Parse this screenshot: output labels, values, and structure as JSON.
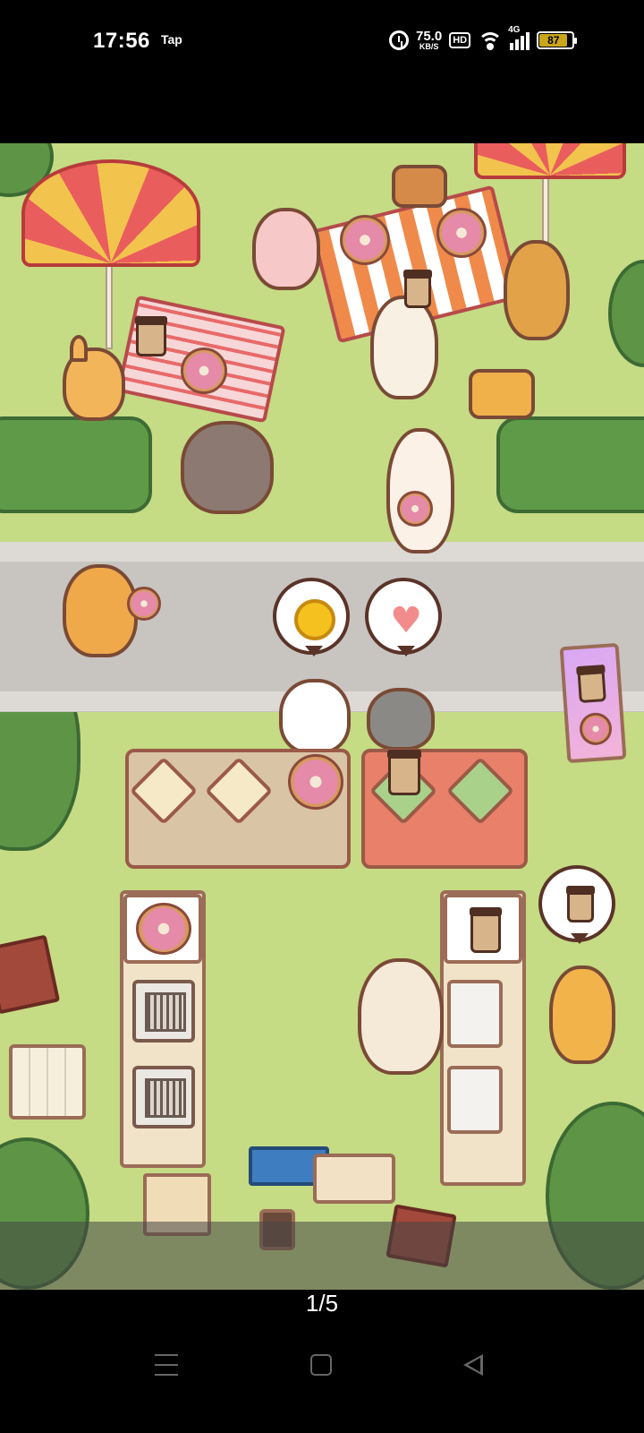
{
  "status_bar": {
    "time": "17:56",
    "carrier": "Tap",
    "net_speed_value": "75.0",
    "net_speed_unit": "KB/S",
    "hd_label": "HD",
    "network_type": "4G",
    "battery_level": "87",
    "icons": [
      "alarm-icon",
      "hd-icon",
      "wifi-icon",
      "signal-icon",
      "battery-icon"
    ]
  },
  "game": {
    "scene": "cat cafe picnic park",
    "customer_bubbles": [
      "coin-icon",
      "heart-icon",
      "coffee-icon"
    ],
    "counter_items": [
      "donut",
      "coffee"
    ],
    "stations": [
      "donut",
      "fryer",
      "fryer",
      "coffee",
      "coffee-machine",
      "coffee-machine"
    ],
    "colors": {
      "grass": "#c5db84",
      "road": "#c8c5c1",
      "umbrella_red": "#ea5d5d",
      "umbrella_yellow": "#f2c34d"
    }
  },
  "pager": {
    "label": "1/5"
  },
  "nav_bar": {
    "icons": [
      "menu-icon",
      "home-icon",
      "back-icon"
    ]
  }
}
